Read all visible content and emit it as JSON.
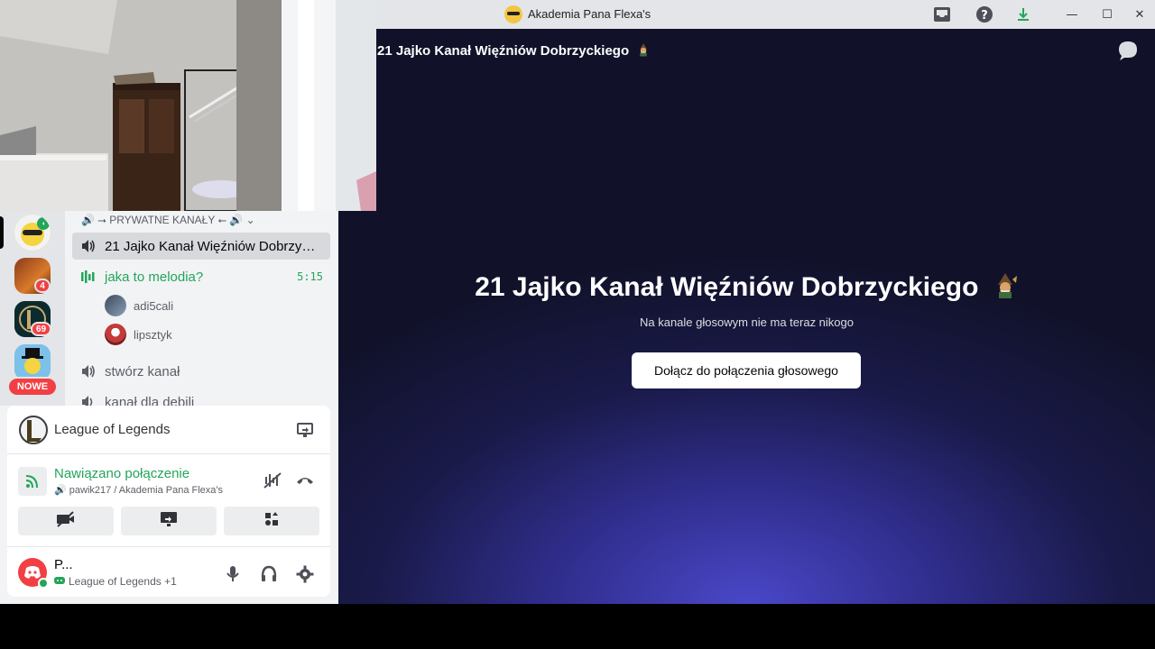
{
  "window": {
    "title": "Akademia Pana Flexa's",
    "controls": [
      "—",
      "☐",
      "✕"
    ]
  },
  "sidebar": {
    "category": "🔊 ⭢ PRYWATNE KANAŁY ⭠ 🔊",
    "channels": [
      {
        "name": "21 Jajko Kanał Więźniów Dobrzy…"
      },
      {
        "name": "jaka to melodia?",
        "time": "5:15"
      },
      {
        "name": "stwórz kanał"
      },
      {
        "name": "kanał dla debili"
      }
    ],
    "voice_users": [
      "adi5cali",
      "lipsztyk"
    ]
  },
  "servers": {
    "badges": [
      "4",
      "69"
    ],
    "new_label": "NOWE"
  },
  "activity": {
    "name": "League of Legends"
  },
  "connection": {
    "status": "Nawiązano połączenie",
    "details": "pawik217 / Akademia Pana Flexa's"
  },
  "user": {
    "name": "P...",
    "activity": "League of Legends",
    "extra": "+1"
  },
  "main": {
    "header": "21 Jajko Kanał Więźniów Dobrzyckiego",
    "title": "21 Jajko Kanał Więźniów Dobrzyckiego",
    "subtitle": "Na kanale głosowym nie ma teraz nikogo",
    "join_button": "Dołącz do połączenia głosowego"
  },
  "colors": {
    "accent_green": "#23a559",
    "danger_red": "#f23f43",
    "main_bg": "#1a1a4a"
  }
}
